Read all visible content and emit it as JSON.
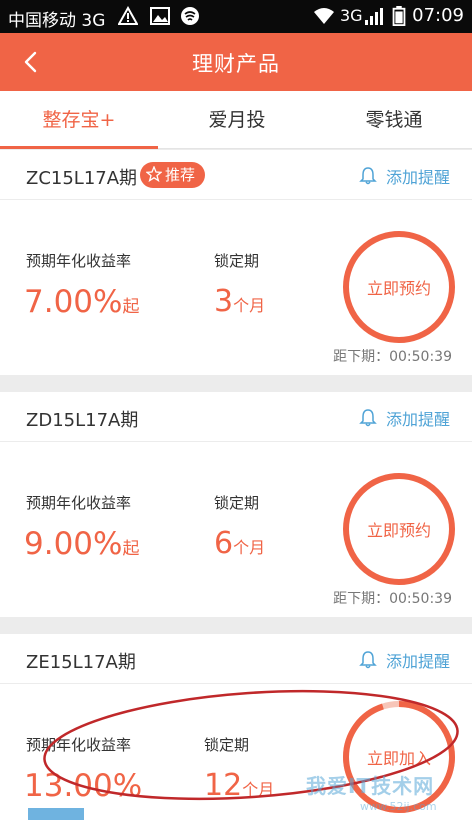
{
  "status_bar": {
    "carrier": "中国移动 3G",
    "network": "3G",
    "time": "07:09"
  },
  "header": {
    "title": "理财产品",
    "back_icon": "chevron-left-icon"
  },
  "tabs": [
    {
      "label": "整存宝+",
      "active": true
    },
    {
      "label": "爱月投",
      "active": false
    },
    {
      "label": "零钱通",
      "active": false
    }
  ],
  "products": [
    {
      "code": "ZC15L17A期",
      "badge": "推荐",
      "remind_label": "添加提醒",
      "rate_label": "预期年化收益率",
      "rate_value": "7.00%",
      "rate_suffix": "起",
      "lock_label": "锁定期",
      "lock_value": "3",
      "lock_unit": "个月",
      "action": "立即预约",
      "countdown": "距下期：00:50:39"
    },
    {
      "code": "ZD15L17A期",
      "remind_label": "添加提醒",
      "rate_label": "预期年化收益率",
      "rate_value": "9.00%",
      "rate_suffix": "起",
      "lock_label": "锁定期",
      "lock_value": "6",
      "lock_unit": "个月",
      "action": "立即预约",
      "countdown": "距下期：00:50:39"
    },
    {
      "code": "ZE15L17A期",
      "remind_label": "添加提醒",
      "rate_label": "预期年化收益率",
      "rate_value": "13.00%",
      "lock_label": "锁定期",
      "lock_value": "12",
      "lock_unit": "个月",
      "action": "立即加入",
      "progress": 0.95
    }
  ],
  "watermark": {
    "text": "我爱IT技术网",
    "url_text": "www.52ij.com"
  },
  "colors": {
    "brand": "#f06446",
    "link": "#4fa3d6",
    "status_bar": "#0a0a0a"
  }
}
